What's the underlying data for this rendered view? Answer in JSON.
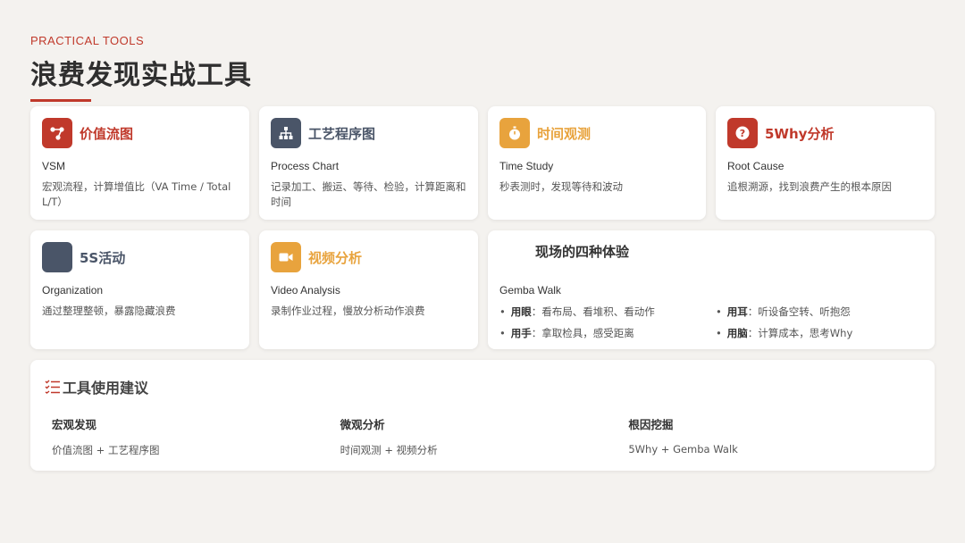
{
  "header": {
    "kicker": "PRACTICAL TOOLS",
    "title": "浪费发现实战工具"
  },
  "colors": {
    "accent_red": "#c0392b",
    "slate": "#4a5568",
    "amber": "#e8a33d"
  },
  "cards": [
    {
      "title": "价值流图",
      "subtitle": "VSM",
      "desc": "宏观流程，计算增值比（VA Time / Total L/T）",
      "icon": "flow-nodes-icon",
      "color": "red"
    },
    {
      "title": "工艺程序图",
      "subtitle": "Process Chart",
      "desc": "记录加工、搬运、等待、检验，计算距离和时间",
      "icon": "hierarchy-icon",
      "color": "slate"
    },
    {
      "title": "时间观测",
      "subtitle": "Time Study",
      "desc": "秒表测时，发现等待和波动",
      "icon": "stopwatch-icon",
      "color": "amber"
    },
    {
      "title": "5Why分析",
      "subtitle": "Root Cause",
      "desc": "追根溯源，找到浪费产生的根本原因",
      "icon": "question-icon",
      "color": "red"
    },
    {
      "title": "5S活动",
      "subtitle": "Organization",
      "desc": "通过整理整顿，暴露隐藏浪费",
      "icon": "blank-icon",
      "color": "slate"
    },
    {
      "title": "视频分析",
      "subtitle": "Video Analysis",
      "desc": "录制作业过程，慢放分析动作浪费",
      "icon": "video-camera-icon",
      "color": "amber"
    }
  ],
  "gemba": {
    "title": "现场的四种体验",
    "subtitle": "Gemba Walk",
    "points": [
      {
        "label": "用眼",
        "text": "：看布局、看堆积、看动作"
      },
      {
        "label": "用耳",
        "text": "：听设备空转、听抱怨"
      },
      {
        "label": "用手",
        "text": "：拿取检具，感受距离"
      },
      {
        "label": "用脑",
        "text": "：计算成本，思考Why"
      }
    ]
  },
  "advice": {
    "title": "工具使用建议",
    "icon": "list-check-icon",
    "columns": [
      {
        "heading": "宏观发现",
        "text": "价值流图 + 工艺程序图"
      },
      {
        "heading": "微观分析",
        "text": "时间观测 + 视频分析"
      },
      {
        "heading": "根因挖掘",
        "text": "5Why + Gemba Walk"
      }
    ]
  }
}
